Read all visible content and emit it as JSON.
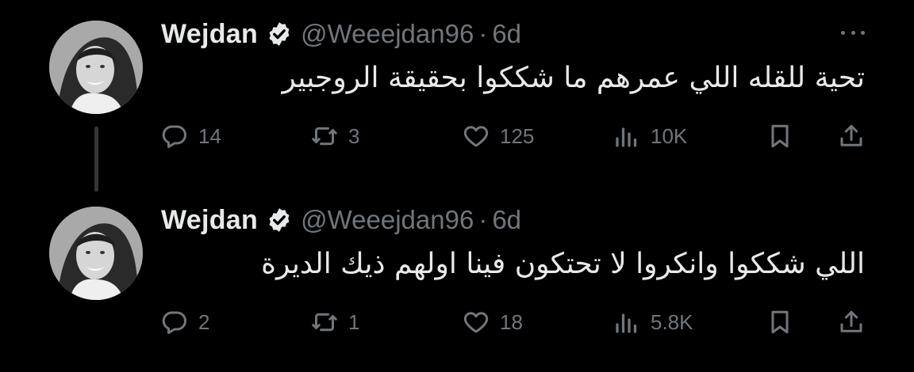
{
  "tweets": [
    {
      "name": "Wejdan",
      "handle": "@Weeejdan96",
      "separator": "·",
      "time": "6d",
      "text": "تحية للقله اللي عمرهم ما شككوا بحقيقة الروجبير",
      "stats": {
        "replies": "14",
        "retweets": "3",
        "likes": "125",
        "views": "10K"
      }
    },
    {
      "name": "Wejdan",
      "handle": "@Weeejdan96",
      "separator": "·",
      "time": "6d",
      "text": "اللي شككوا وانكروا لا تحتكون فينا اولهم ذيك الديرة",
      "stats": {
        "replies": "2",
        "retweets": "1",
        "likes": "18",
        "views": "5.8K"
      }
    }
  ],
  "icons": {
    "verified": "verified-badge-icon",
    "more": "more-dots-icon",
    "reply": "reply-icon",
    "retweet": "retweet-icon",
    "like": "heart-icon",
    "views": "views-icon",
    "bookmark": "bookmark-icon",
    "share": "share-icon"
  },
  "colors": {
    "background": "#000000",
    "primary_text": "#e7e9ea",
    "secondary_text": "#71767b",
    "thread_line": "#333639"
  }
}
